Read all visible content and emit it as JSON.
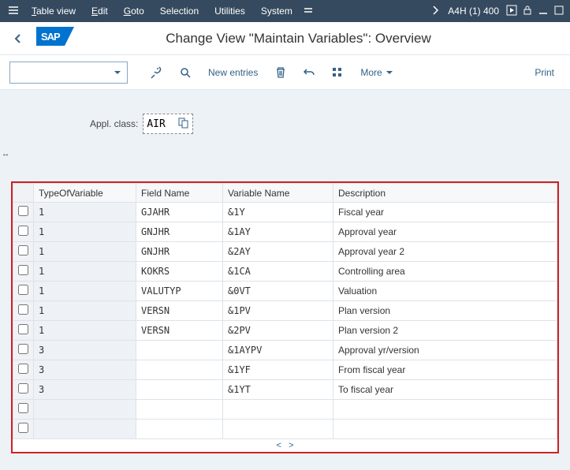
{
  "menubar": {
    "items": [
      "Table view",
      "Edit",
      "Goto",
      "Selection",
      "Utilities",
      "System"
    ],
    "session": "A4H (1) 400"
  },
  "title": "Change View \"Maintain Variables\": Overview",
  "toolbar": {
    "new_entries": "New entries",
    "more": "More",
    "print": "Print"
  },
  "appl": {
    "label": "Appl. class:",
    "value": "AIR"
  },
  "columns": [
    "TypeOfVariable",
    "Field Name",
    "Variable Name",
    "Description"
  ],
  "rows": [
    {
      "t": "1",
      "f": "GJAHR",
      "v": "&1Y",
      "d": "Fiscal year"
    },
    {
      "t": "1",
      "f": "GNJHR",
      "v": "&1AY",
      "d": "Approval year"
    },
    {
      "t": "1",
      "f": "GNJHR",
      "v": "&2AY",
      "d": "Approval year 2"
    },
    {
      "t": "1",
      "f": "KOKRS",
      "v": "&1CA",
      "d": "Controlling area"
    },
    {
      "t": "1",
      "f": "VALUTYP",
      "v": "&0VT",
      "d": "Valuation"
    },
    {
      "t": "1",
      "f": "VERSN",
      "v": "&1PV",
      "d": "Plan version"
    },
    {
      "t": "1",
      "f": "VERSN",
      "v": "&2PV",
      "d": "Plan version 2"
    },
    {
      "t": "3",
      "f": "",
      "v": "&1AYPV",
      "d": "Approval yr/version"
    },
    {
      "t": "3",
      "f": "",
      "v": "&1YF",
      "d": "From fiscal year"
    },
    {
      "t": "3",
      "f": "",
      "v": "&1YT",
      "d": "To fiscal year"
    }
  ]
}
